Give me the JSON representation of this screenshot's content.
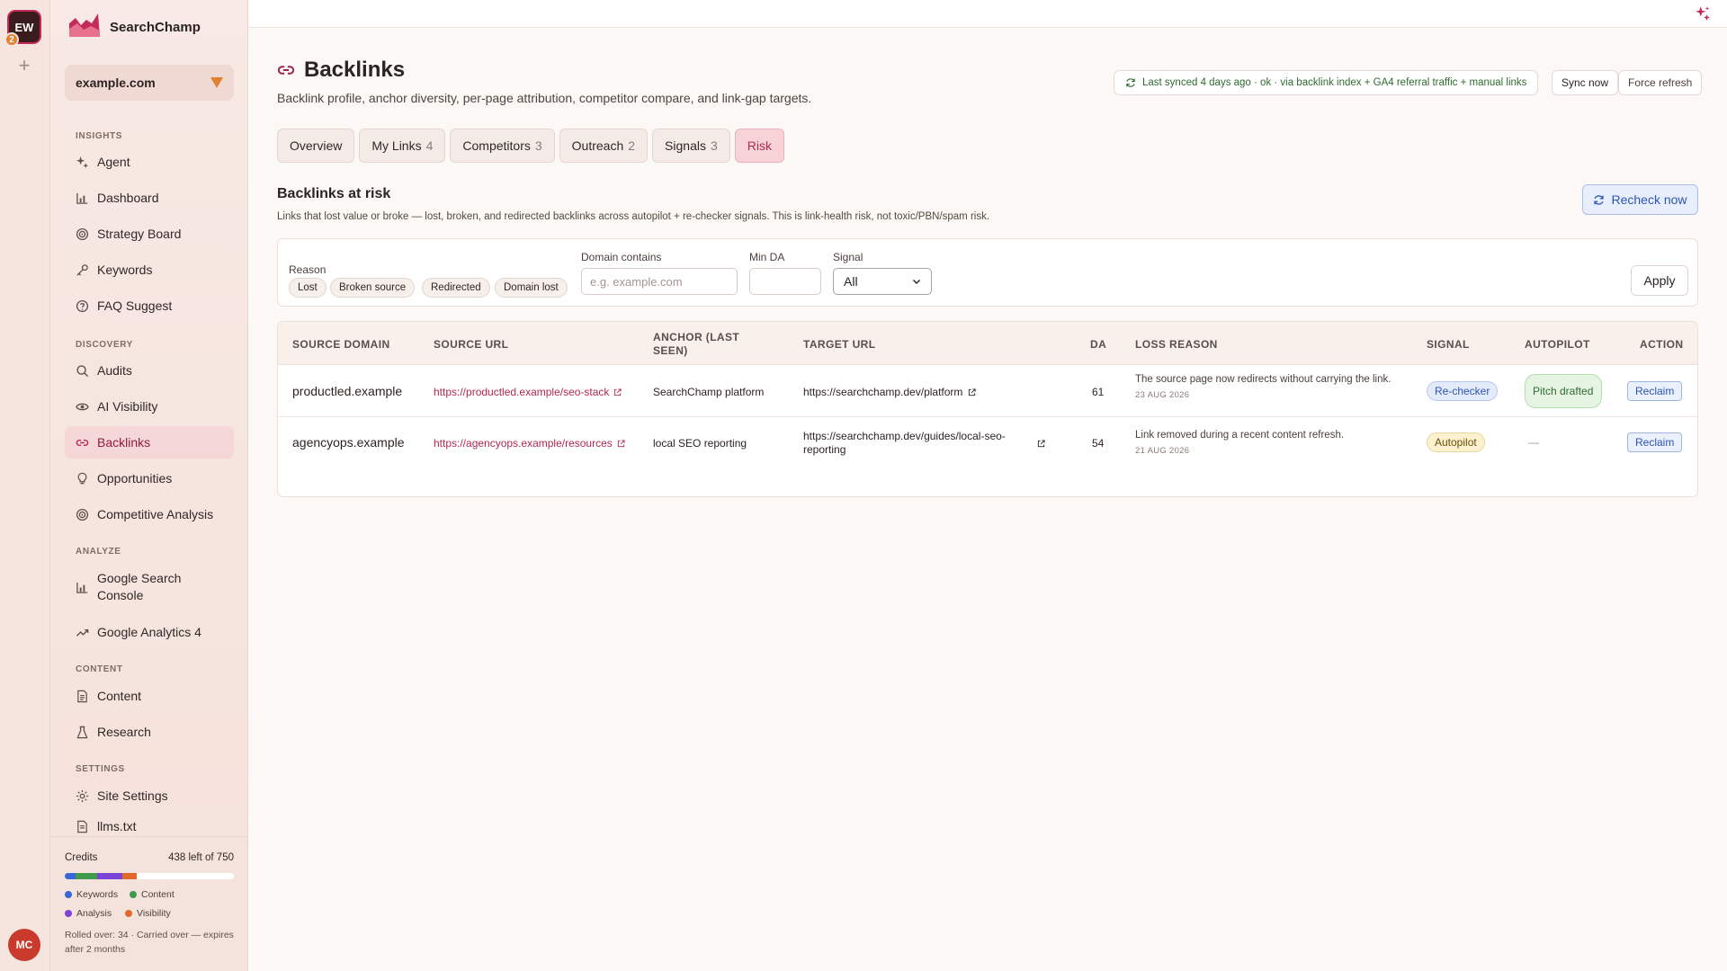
{
  "rail": {
    "workspace_initials": "EW",
    "workspace_badge": "2",
    "add_icon": "+",
    "user_initials": "MC"
  },
  "brand": {
    "name": "SearchChamp",
    "logo_icon": "crown-chart-logo"
  },
  "site": {
    "selected": "example.com"
  },
  "nav": {
    "sections": {
      "insights": "INSIGHTS",
      "discovery": "DISCOVERY",
      "analyze": "ANALYZE",
      "content": "CONTENT",
      "settings": "SETTINGS"
    },
    "items": [
      {
        "label": "Agent",
        "icon": "sparkle-icon"
      },
      {
        "label": "Dashboard",
        "icon": "bar-chart-icon"
      },
      {
        "label": "Strategy Board",
        "icon": "target-icon"
      },
      {
        "label": "Keywords",
        "icon": "key-icon"
      },
      {
        "label": "FAQ Suggest",
        "icon": "question-icon"
      },
      {
        "label": "Audits",
        "icon": "search-icon"
      },
      {
        "label": "AI Visibility",
        "icon": "eye-icon"
      },
      {
        "label": "Backlinks",
        "icon": "link-icon"
      },
      {
        "label": "Opportunities",
        "icon": "lightbulb-icon"
      },
      {
        "label": "Competitive Analysis",
        "icon": "target-icon"
      },
      {
        "label": "Google Search Console",
        "icon": "bar-chart-icon"
      },
      {
        "label": "Google Analytics 4",
        "icon": "trend-icon"
      },
      {
        "label": "Content",
        "icon": "document-icon"
      },
      {
        "label": "Research",
        "icon": "flask-icon"
      },
      {
        "label": "Site Settings",
        "icon": "gear-icon"
      },
      {
        "label": "llms.txt",
        "icon": "document-icon"
      }
    ]
  },
  "credits": {
    "label": "Credits",
    "remaining": "438 left of 750",
    "legend": [
      "Keywords",
      "Content",
      "Analysis",
      "Visibility"
    ],
    "colors": [
      "#3a66d8",
      "#3f9a4f",
      "#7a45d6",
      "#e0682d"
    ],
    "rolled": "Rolled over: 34 · Carried over — expires after 2 months"
  },
  "page": {
    "title": "Backlinks",
    "subtitle": "Backlink profile, anchor diversity, per-page attribution, competitor compare, and link-gap targets.",
    "sync_status": "Last synced 4 days ago · ok · via backlink index + GA4 referral traffic + manual links",
    "sync_now": "Sync now",
    "force_refresh": "Force refresh"
  },
  "tabs": [
    {
      "label": "Overview",
      "count": ""
    },
    {
      "label": "My Links",
      "count": "4"
    },
    {
      "label": "Competitors",
      "count": "3"
    },
    {
      "label": "Outreach",
      "count": "2"
    },
    {
      "label": "Signals",
      "count": "3"
    },
    {
      "label": "Risk",
      "count": ""
    }
  ],
  "risk": {
    "title": "Backlinks at risk",
    "description": "Links that lost value or broke — lost, broken, and redirected backlinks across autopilot + re-checker signals. This is link-health risk, not toxic/PBN/spam risk.",
    "recheck": "Recheck now"
  },
  "filters": {
    "reason_label": "Reason",
    "reasons": [
      "Lost",
      "Broken source",
      "Redirected",
      "Domain lost"
    ],
    "domain_label": "Domain contains",
    "domain_placeholder": "e.g. example.com",
    "min_da_label": "Min DA",
    "signal_label": "Signal",
    "signal_value": "All",
    "apply": "Apply"
  },
  "table": {
    "headers": [
      "SOURCE DOMAIN",
      "SOURCE URL",
      "ANCHOR (LAST SEEN)",
      "TARGET URL",
      "DA",
      "LOSS REASON",
      "SIGNAL",
      "AUTOPILOT",
      "ACTION"
    ],
    "rows": [
      {
        "source_domain": "productled.example",
        "source_url": "https://productled.example/seo-stack",
        "anchor": "SearchChamp platform",
        "target_url": "https://searchchamp.dev/platform",
        "da": "61",
        "loss_reason": "The source page now redirects without carrying the link.",
        "loss_date": "23 AUG 2026",
        "signal": "Re-checker",
        "autopilot": "Pitch drafted",
        "action": "Reclaim"
      },
      {
        "source_domain": "agencyops.example",
        "source_url": "https://agencyops.example/resources",
        "anchor": "local SEO reporting",
        "target_url": "https://searchchamp.dev/guides/local-seo-reporting",
        "da": "54",
        "loss_reason": "Link removed during a recent content refresh.",
        "loss_date": "21 AUG 2026",
        "signal": "Autopilot",
        "autopilot": "—",
        "action": "Reclaim"
      }
    ]
  }
}
